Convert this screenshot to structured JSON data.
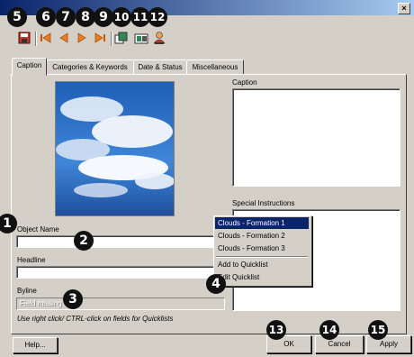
{
  "window": {
    "close_glyph": "×"
  },
  "toolbar": {
    "buttons": [
      {
        "icon": "save-icon"
      },
      {
        "icon": "first-record-icon"
      },
      {
        "icon": "previous-record-icon"
      },
      {
        "icon": "next-record-icon"
      },
      {
        "icon": "last-record-icon"
      },
      {
        "icon": "copy-fields-icon"
      },
      {
        "icon": "paste-fields-icon"
      },
      {
        "icon": "user-template-icon"
      }
    ]
  },
  "tabs": [
    {
      "label": "Caption"
    },
    {
      "label": "Categories & Keywords"
    },
    {
      "label": "Date & Status"
    },
    {
      "label": "Miscellaneous"
    }
  ],
  "fields": {
    "caption_label": "Caption",
    "special_instructions_label": "Special Instructions",
    "object_name_label": "Object Name",
    "headline_label": "Headline",
    "byline_label": "Byline",
    "byline_placeholder": "Field missing",
    "quicklist_hint": "Use right click/ CTRL-click on fields for Quicklists"
  },
  "context_menu": {
    "items": [
      "Clouds -  Formation 1",
      "Clouds -  Formation 2",
      "Clouds -  Formation 3"
    ],
    "add_label": "Add to Quicklist",
    "edit_label": "Edit Quicklist"
  },
  "buttons": {
    "help": "Help...",
    "ok": "OK",
    "cancel": "Cancel",
    "apply": "Apply"
  },
  "callouts": [
    "1",
    "2",
    "3",
    "4",
    "5",
    "6",
    "7",
    "8",
    "9",
    "10",
    "11",
    "12",
    "13",
    "14",
    "15"
  ],
  "colors": {
    "titlebar_start": "#0a246a",
    "selection": "#0a246a",
    "face": "#d4d0c8"
  }
}
